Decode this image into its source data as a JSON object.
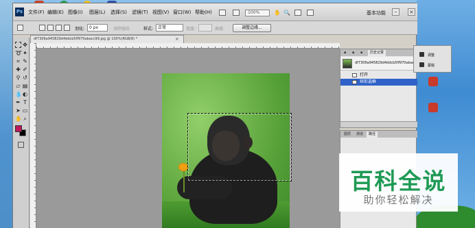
{
  "menubar": {
    "app_icon": "Ps",
    "items": [
      "文件(F)",
      "编辑(E)",
      "图像(I)",
      "图层(L)",
      "选择(S)",
      "滤镜(T)",
      "视图(V)",
      "窗口(W)",
      "帮助(H)"
    ],
    "zoom": "100%",
    "workspace": "基本功能"
  },
  "options": {
    "feather_label": "羽化:",
    "feather_value": "0 px",
    "antialias_label": "消除锯齿",
    "style_label": "样式:",
    "style_value": "正常",
    "width_label": "宽度:",
    "height_label": "高度:",
    "refine_edge_button": "调整边缘..."
  },
  "document": {
    "tab_title": "df7306a945829d4ddcb5ff970abacc99.jpg @ 100%(RGB/8) *",
    "close": "×"
  },
  "history": {
    "tabs": [
      "历史记录"
    ],
    "snapshot": "df7306a945829d4ddcb5ff970abacc...",
    "steps": [
      {
        "label": "打开",
        "selected": false
      },
      {
        "label": "矩形选框",
        "selected": true
      }
    ]
  },
  "layers": {
    "tabs": [
      "图层",
      "通道",
      "路径"
    ]
  },
  "adjustments": {
    "items": [
      "调整",
      "蒙版"
    ]
  },
  "watermark": {
    "title": "百科全说",
    "subtitle": "助你轻松解决"
  },
  "colors": {
    "foreground": "#c2185b",
    "background": "#000000",
    "selection_highlight": "#2f62c8",
    "watermark_green": "#1f9a55"
  }
}
